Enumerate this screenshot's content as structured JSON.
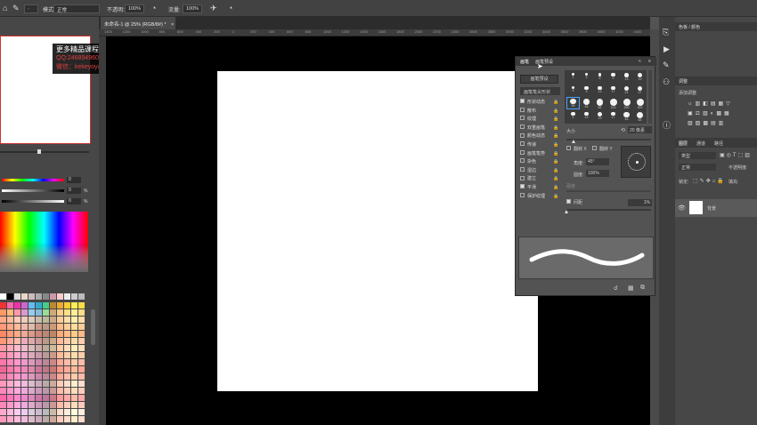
{
  "options_bar": {
    "mode_label": "模式:",
    "mode_value": "正常",
    "opacity_label": "不透明:",
    "opacity_value": "100%",
    "flow_label": "流量:",
    "flow_value": "100%"
  },
  "document": {
    "tab_title": "未命名-1 @ 25% (RGB/8#) *"
  },
  "ruler_ticks": [
    "1400",
    "1200",
    "1000",
    "800",
    "600",
    "400",
    "200",
    "0",
    "200",
    "400",
    "600",
    "800",
    "1000",
    "1200",
    "1400",
    "1600",
    "1800",
    "2000",
    "2200",
    "2400",
    "2600",
    "2800",
    "3000",
    "3200",
    "3400",
    "3600",
    "3800",
    "4000",
    "4200",
    "4400"
  ],
  "watermark": {
    "line1": "更多精品课程联系",
    "line2": "QQ:2468949606",
    "line3": "微信：kekeyoya"
  },
  "color_sliders": [
    {
      "value": "0",
      "unit": ""
    },
    {
      "value": "0",
      "unit": "%"
    },
    {
      "value": "0",
      "unit": "%"
    }
  ],
  "brush_panel": {
    "tab1": "画笔",
    "tab2": "画笔预设",
    "preset_button": "画笔预设",
    "tip_shape": "画笔笔尖形状",
    "options": [
      {
        "label": "形状动态",
        "checked": true
      },
      {
        "label": "散布",
        "checked": false
      },
      {
        "label": "纹理",
        "checked": false
      },
      {
        "label": "双重画笔",
        "checked": false
      },
      {
        "label": "颜色动态",
        "checked": false
      },
      {
        "label": "传递",
        "checked": false
      },
      {
        "label": "画笔笔势",
        "checked": false
      },
      {
        "label": "杂色",
        "checked": false
      },
      {
        "label": "湿边",
        "checked": false
      },
      {
        "label": "建立",
        "checked": false
      },
      {
        "label": "平滑",
        "checked": true
      },
      {
        "label": "保护纹理",
        "checked": false
      }
    ],
    "tip_sizes": [
      "1",
      "3",
      "5",
      "9",
      "13",
      "19",
      "5",
      "9",
      "13",
      "17",
      "21",
      "27",
      "35",
      "45",
      "65",
      "100",
      "200",
      "300",
      "9",
      "13",
      "19",
      "17",
      "45",
      "65"
    ],
    "size_label": "大小",
    "size_value": "20 像素",
    "flip_x": "翻转 X",
    "flip_y": "翻转 Y",
    "angle_label": "角度:",
    "angle_value": "45°",
    "roundness_label": "圆度:",
    "roundness_value": "100%",
    "hardness_label": "硬度",
    "spacing_label": "间距",
    "spacing_value": "1%"
  },
  "right_panels": {
    "color_panel_title": "色板 / 颜色",
    "adjust_tab": "调整",
    "add_adjust_label": "添加调整",
    "layers_tabs": [
      "图层",
      "通道",
      "路径"
    ],
    "kind_placeholder": "类型",
    "blend_mode": "正常",
    "opacity_label": "不透明度:",
    "lock_label": "锁定:",
    "fill_label": "填充:",
    "layer_name": "背景"
  },
  "colors": {
    "app_bg": "#535353",
    "panel": "#474747",
    "canvas": "#000000",
    "document": "#ffffff",
    "watermark_red": "#e04040"
  }
}
